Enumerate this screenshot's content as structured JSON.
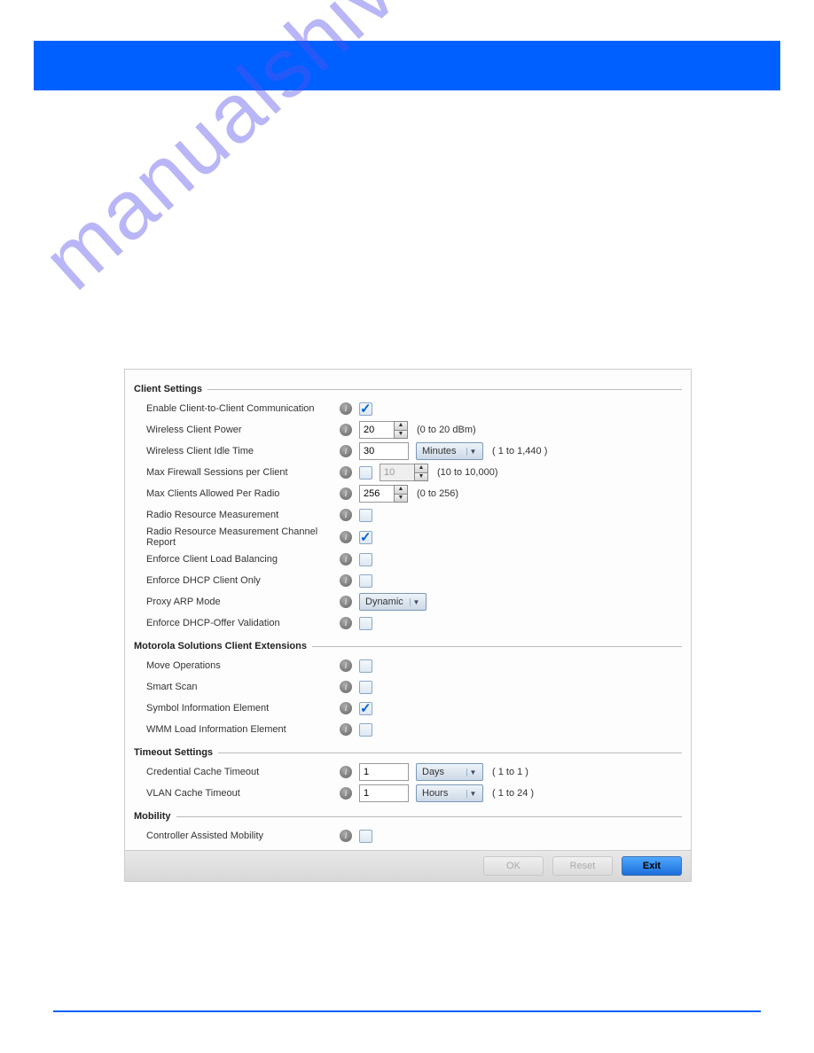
{
  "watermark": "manualshive.com",
  "sections": {
    "client": {
      "title": "Client Settings",
      "enable_c2c": {
        "label": "Enable Client-to-Client Communication",
        "checked": true
      },
      "wireless_power": {
        "label": "Wireless Client Power",
        "value": "20",
        "hint": "(0 to 20 dBm)"
      },
      "idle_time": {
        "label": "Wireless Client Idle Time",
        "value": "30",
        "unit": "Minutes",
        "hint": "( 1 to 1,440 )"
      },
      "max_fw": {
        "label": "Max Firewall Sessions per Client",
        "checked": false,
        "value": "10",
        "hint": "(10 to 10,000)"
      },
      "max_clients": {
        "label": "Max Clients Allowed Per Radio",
        "value": "256",
        "hint": "(0 to 256)"
      },
      "rrm": {
        "label": "Radio Resource Measurement",
        "checked": false
      },
      "rrm_ch": {
        "label": "Radio Resource Measurement Channel Report",
        "checked": true
      },
      "load_bal": {
        "label": "Enforce Client Load Balancing",
        "checked": false
      },
      "dhcp_only": {
        "label": "Enforce DHCP Client Only",
        "checked": false
      },
      "proxy_arp": {
        "label": "Proxy ARP Mode",
        "value": "Dynamic"
      },
      "dhcp_offer": {
        "label": "Enforce DHCP-Offer Validation",
        "checked": false
      }
    },
    "moto": {
      "title": "Motorola Solutions Client Extensions",
      "move": {
        "label": "Move Operations",
        "checked": false
      },
      "smart": {
        "label": "Smart Scan",
        "checked": false
      },
      "symbol": {
        "label": "Symbol Information Element",
        "checked": true
      },
      "wmm": {
        "label": "WMM Load Information Element",
        "checked": false
      }
    },
    "timeout": {
      "title": "Timeout Settings",
      "cred": {
        "label": "Credential Cache Timeout",
        "value": "1",
        "unit": "Days",
        "hint": "( 1 to 1 )"
      },
      "vlan": {
        "label": "VLAN Cache Timeout",
        "value": "1",
        "unit": "Hours",
        "hint": "( 1 to 24 )"
      }
    },
    "mobility": {
      "title": "Mobility",
      "cam": {
        "label": "Controller Assisted Mobility",
        "checked": false
      }
    }
  },
  "footer": {
    "ok": "OK",
    "reset": "Reset",
    "exit": "Exit"
  }
}
